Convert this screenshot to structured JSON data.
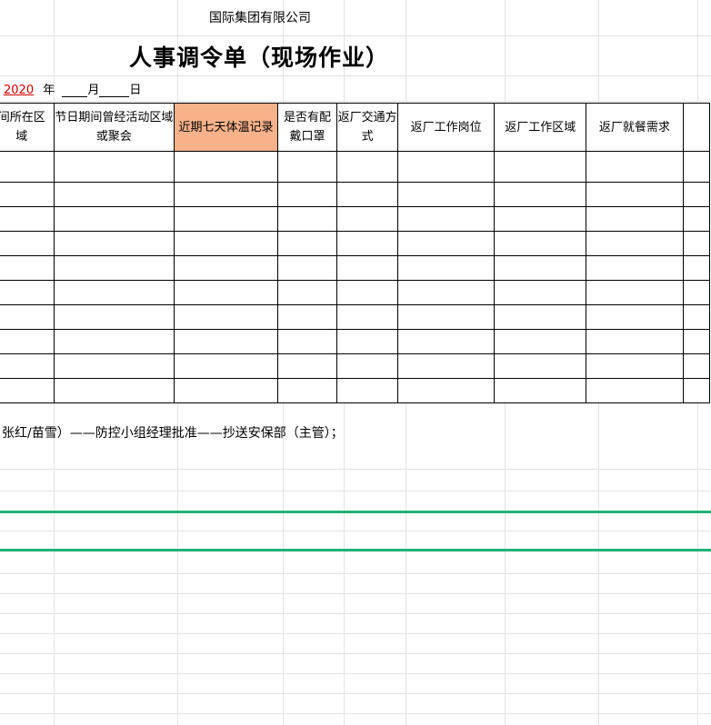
{
  "company": "国际集团有限公司",
  "title": "人事调令单（现场作业）",
  "date": {
    "year": "2020",
    "year_suffix": "年",
    "month_suffix": "月",
    "day_suffix": "日"
  },
  "columns": [
    "期间所在区域",
    "节日期间曾经活动区域或聚会",
    "近期七天体温记录",
    "是否有配戴口罩",
    "返厂交通方式",
    "返厂工作岗位",
    "返厂工作区域",
    "返厂就餐需求"
  ],
  "col0_visible_lines": [
    "间所在区",
    "域"
  ],
  "note": "张红/苗雪）——防控小组经理批准——抄送安保部（主管）；",
  "colors": {
    "highlight": "#f7b28a",
    "year_red": "#d40000",
    "green_rule": "#21b07a",
    "gridline": "#e3e3e3"
  }
}
